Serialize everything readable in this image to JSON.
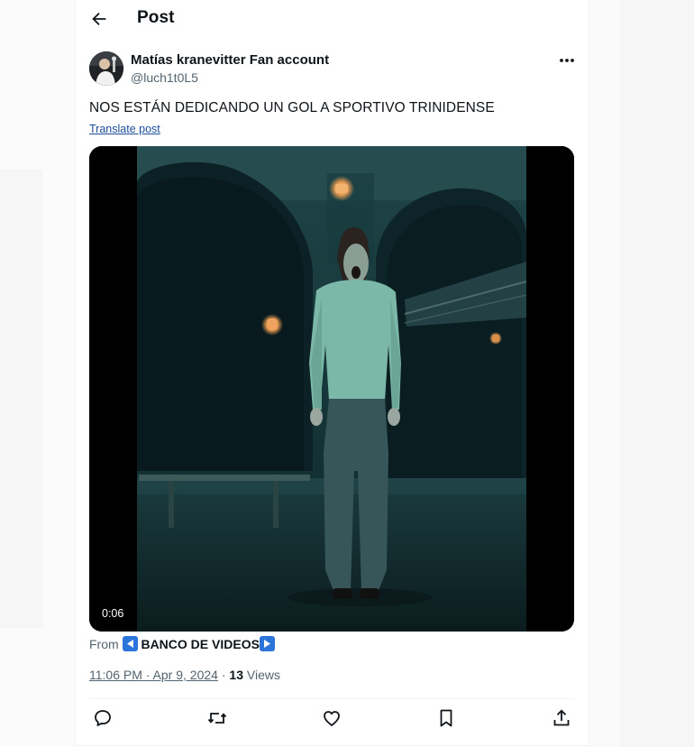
{
  "header": {
    "back_icon": "arrow-left-icon",
    "title": "Post"
  },
  "post": {
    "author": {
      "display_name": "Matías kranevitter Fan account",
      "handle": "@luch1t0L5",
      "avatar_icon": "user-avatar"
    },
    "more_icon": "more-horizontal-icon",
    "text": "NOS ESTÁN DEDICANDO UN GOL A SPORTIVO TRINIDENSE",
    "translate_label": "Translate post",
    "media": {
      "type": "video",
      "duration": "0:06"
    },
    "source": {
      "prefix": "From",
      "left_arrow": "◀️",
      "name": "BANCO DE VIDEOS",
      "right_arrow": "▶️"
    },
    "timestamp": "11:06 PM · Apr 9, 2024",
    "separator": "·",
    "views_count": "13",
    "views_label": "Views"
  },
  "actions": [
    {
      "name": "reply-icon"
    },
    {
      "name": "repost-icon"
    },
    {
      "name": "like-icon"
    },
    {
      "name": "bookmark-icon"
    },
    {
      "name": "share-icon"
    }
  ],
  "colors": {
    "text_primary": "#0f1419",
    "text_secondary": "#536471",
    "link": "#1d4e9a",
    "divider": "#eff3f4",
    "emoji_badge": "#2b74d9"
  }
}
